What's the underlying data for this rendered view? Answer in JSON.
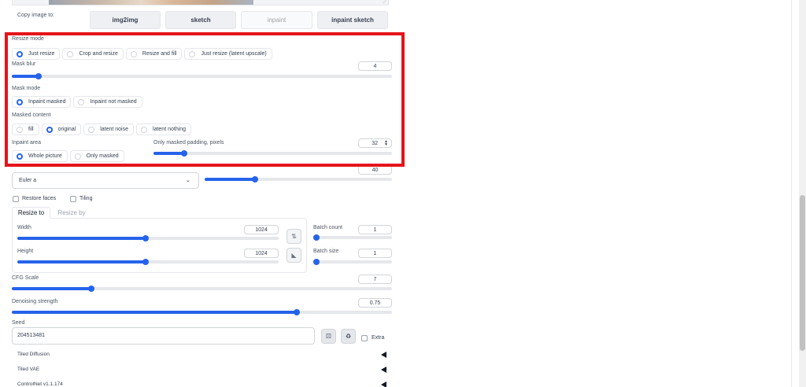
{
  "copy_image": {
    "label": "Copy image to:",
    "buttons": [
      "img2img",
      "sketch",
      "inpaint",
      "inpaint sketch"
    ]
  },
  "resize_mode": {
    "label": "Resize mode",
    "options": [
      "Just resize",
      "Crop and resize",
      "Resize and fill",
      "Just resize (latent upscale)"
    ],
    "selected": "Just resize"
  },
  "mask_blur": {
    "label": "Mask blur",
    "value": "4",
    "fraction": 0.07
  },
  "mask_mode": {
    "label": "Mask mode",
    "options": [
      "Inpaint masked",
      "Inpaint not masked"
    ],
    "selected": "Inpaint masked"
  },
  "masked_content": {
    "label": "Masked content",
    "options": [
      "fill",
      "original",
      "latent noise",
      "latent nothing"
    ],
    "selected": "original"
  },
  "inpaint_area": {
    "label": "Inpaint area",
    "options": [
      "Whole picture",
      "Only masked"
    ],
    "selected": "Whole picture"
  },
  "only_masked_padding": {
    "label": "Only masked padding, pixels",
    "value": "32",
    "fraction": 0.13
  },
  "sampling": {
    "method_value": "Euler a",
    "steps_value": "40",
    "steps_fraction": 0.27
  },
  "restore_faces": {
    "label": "Restore faces",
    "checked": false
  },
  "tiling": {
    "label": "Tiling",
    "checked": false
  },
  "resize_tabs": [
    "Resize to",
    "Resize by"
  ],
  "width": {
    "label": "Width",
    "value": "1024",
    "fraction": 0.49
  },
  "height": {
    "label": "Height",
    "value": "1024",
    "fraction": 0.49
  },
  "batch_count": {
    "label": "Batch count",
    "value": "1",
    "fraction": 0.0
  },
  "batch_size": {
    "label": "Batch size",
    "value": "1",
    "fraction": 0.0
  },
  "cfg_scale": {
    "label": "CFG Scale",
    "value": "7",
    "fraction": 0.21
  },
  "denoising": {
    "label": "Denoising strength",
    "value": "0.75",
    "fraction": 0.75
  },
  "seed": {
    "label": "Seed",
    "value": "204513481",
    "extra_label": "Extra"
  },
  "accordions": [
    "Tiled Diffusion",
    "Tiled VAE",
    "ControlNet v1.1.174"
  ],
  "colors": {
    "accent": "#2563eb",
    "highlight_border": "#e5141a"
  }
}
